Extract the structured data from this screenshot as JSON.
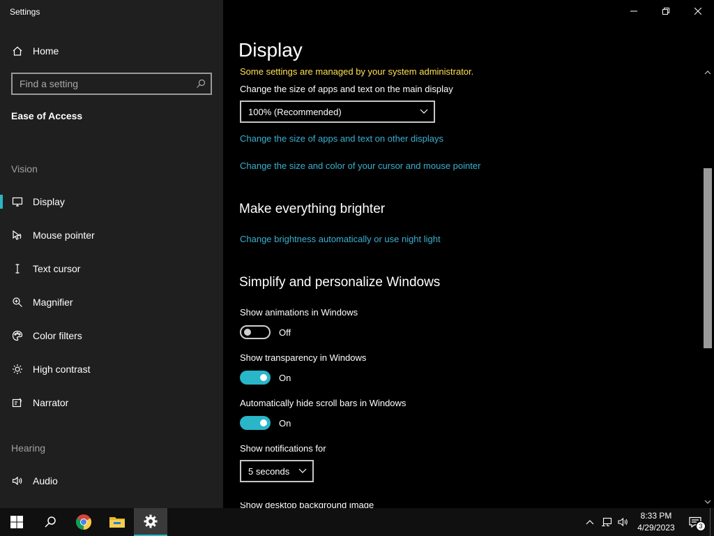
{
  "window": {
    "title": "Settings"
  },
  "sidebar": {
    "home_label": "Home",
    "search_placeholder": "Find a setting",
    "section_heading": "Ease of Access",
    "vision_label": "Vision",
    "vision_items": [
      {
        "label": "Display",
        "icon": "monitor-icon",
        "active": true
      },
      {
        "label": "Mouse pointer",
        "icon": "mouse-pointer-icon"
      },
      {
        "label": "Text cursor",
        "icon": "text-cursor-icon"
      },
      {
        "label": "Magnifier",
        "icon": "magnifier-icon"
      },
      {
        "label": "Color filters",
        "icon": "color-filters-icon"
      },
      {
        "label": "High contrast",
        "icon": "high-contrast-icon"
      },
      {
        "label": "Narrator",
        "icon": "narrator-icon"
      }
    ],
    "hearing_label": "Hearing",
    "hearing_items": [
      {
        "label": "Audio",
        "icon": "speaker-icon"
      }
    ]
  },
  "main": {
    "page_title": "Display",
    "admin_note": "Some settings are managed by your system administrator.",
    "scale_label": "Change the size of apps and text on the main display",
    "scale_value": "100% (Recommended)",
    "link_other_displays": "Change the size of apps and text on other displays",
    "link_cursor": "Change the size and color of your cursor and mouse pointer",
    "brighter_heading": "Make everything brighter",
    "link_brightness": "Change brightness automatically or use night light",
    "simplify_heading": "Simplify and personalize Windows",
    "toggles": [
      {
        "label": "Show animations in Windows",
        "state": "Off",
        "on": false
      },
      {
        "label": "Show transparency in Windows",
        "state": "On",
        "on": true
      },
      {
        "label": "Automatically hide scroll bars in Windows",
        "state": "On",
        "on": true
      }
    ],
    "notifications_label": "Show notifications for",
    "notifications_value": "5 seconds",
    "cut_off_label": "Show desktop background image"
  },
  "taskbar": {
    "time": "8:33 PM",
    "date": "4/29/2023",
    "notification_count": "3",
    "apps": [
      "windows-start-icon",
      "search-icon",
      "chrome-icon",
      "file-explorer-icon",
      "settings-icon"
    ]
  },
  "colors": {
    "accent": "#29b6c8",
    "link": "#3ab0d0",
    "admin_note": "#ffe04f",
    "sidebar_bg": "#1f1f1f",
    "main_bg": "#000000"
  }
}
